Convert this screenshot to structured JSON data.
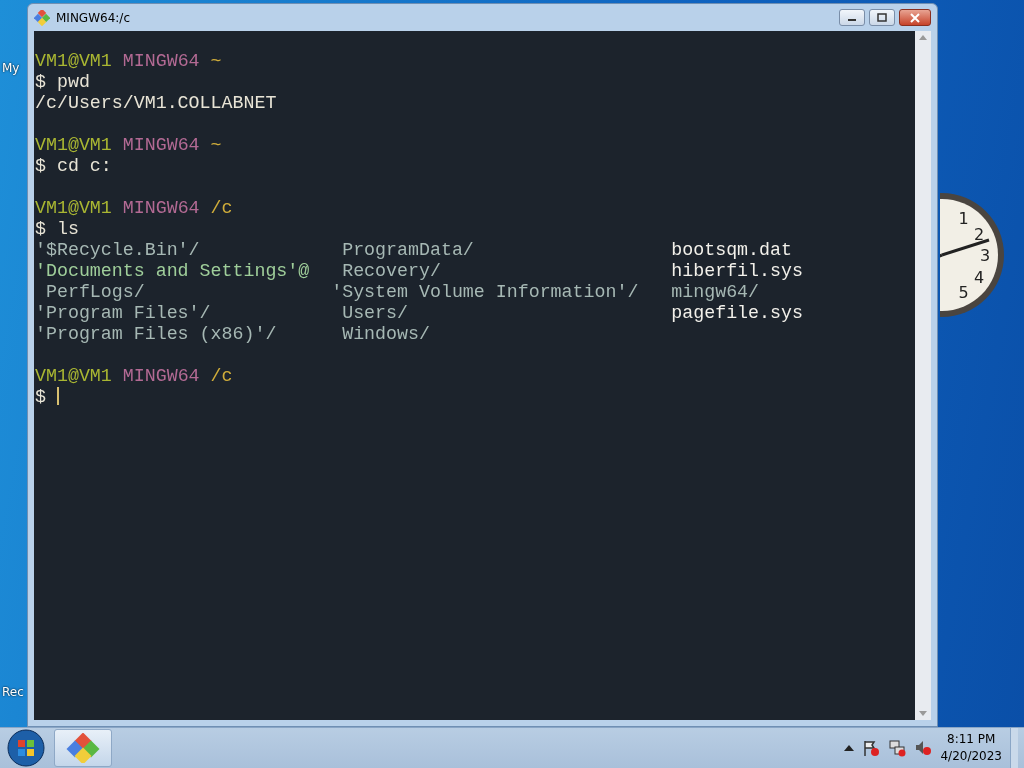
{
  "desktop": {
    "top_icon_label": "My",
    "bottom_icon_label": "Rec",
    "clock": {
      "numerals": [
        "1",
        "2",
        "3",
        "4",
        "5"
      ]
    }
  },
  "window": {
    "title": "MINGW64:/c"
  },
  "terminal": {
    "lines": [
      {
        "kind": "prompt",
        "user": "VM1@VM1",
        "system": "MINGW64",
        "path": "~"
      },
      {
        "kind": "command",
        "text": "$ pwd"
      },
      {
        "kind": "output",
        "text": "/c/Users/VM1.COLLABNET"
      },
      {
        "kind": "blank"
      },
      {
        "kind": "prompt",
        "user": "VM1@VM1",
        "system": "MINGW64",
        "path": "~"
      },
      {
        "kind": "command",
        "text": "$ cd c:"
      },
      {
        "kind": "blank"
      },
      {
        "kind": "prompt",
        "user": "VM1@VM1",
        "system": "MINGW64",
        "path": "/c"
      },
      {
        "kind": "command",
        "text": "$ ls"
      },
      {
        "kind": "listing",
        "rows": [
          [
            {
              "text": "'$Recycle.Bin'/",
              "kind": "dir"
            },
            {
              "text": " ProgramData/",
              "kind": "dir"
            },
            {
              "text": " bootsqm.dat",
              "kind": "file"
            }
          ],
          [
            {
              "text": "'Documents and Settings'@",
              "kind": "link"
            },
            {
              "text": " Recovery/",
              "kind": "dir"
            },
            {
              "text": " hiberfil.sys",
              "kind": "file"
            }
          ],
          [
            {
              "text": " PerfLogs/",
              "kind": "dir"
            },
            {
              "text": "'System Volume Information'/",
              "kind": "dir"
            },
            {
              "text": " mingw64/",
              "kind": "dir"
            }
          ],
          [
            {
              "text": "'Program Files'/",
              "kind": "dir"
            },
            {
              "text": " Users/",
              "kind": "dir"
            },
            {
              "text": " pagefile.sys",
              "kind": "file"
            }
          ],
          [
            {
              "text": "'Program Files (x86)'/",
              "kind": "dir"
            },
            {
              "text": " Windows/",
              "kind": "dir"
            }
          ]
        ]
      },
      {
        "kind": "blank"
      },
      {
        "kind": "prompt",
        "user": "VM1@VM1",
        "system": "MINGW64",
        "path": "/c"
      },
      {
        "kind": "input",
        "text": "$",
        "cursor": true
      }
    ]
  },
  "taskbar": {
    "time": "8:11 PM",
    "date": "4/20/2023"
  }
}
